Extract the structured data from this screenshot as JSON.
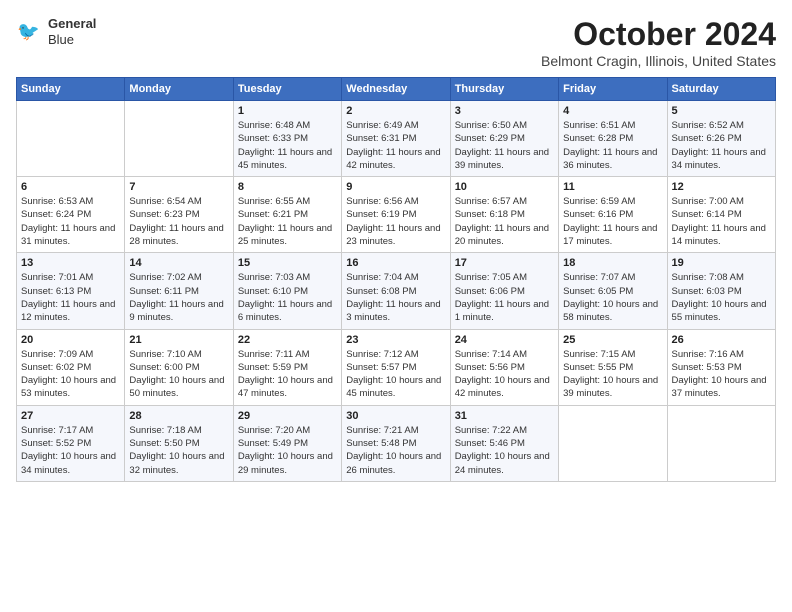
{
  "header": {
    "logo_line1": "General",
    "logo_line2": "Blue",
    "month": "October 2024",
    "location": "Belmont Cragin, Illinois, United States"
  },
  "weekdays": [
    "Sunday",
    "Monday",
    "Tuesday",
    "Wednesday",
    "Thursday",
    "Friday",
    "Saturday"
  ],
  "weeks": [
    [
      {
        "day": "",
        "info": ""
      },
      {
        "day": "",
        "info": ""
      },
      {
        "day": "1",
        "info": "Sunrise: 6:48 AM\nSunset: 6:33 PM\nDaylight: 11 hours and 45 minutes."
      },
      {
        "day": "2",
        "info": "Sunrise: 6:49 AM\nSunset: 6:31 PM\nDaylight: 11 hours and 42 minutes."
      },
      {
        "day": "3",
        "info": "Sunrise: 6:50 AM\nSunset: 6:29 PM\nDaylight: 11 hours and 39 minutes."
      },
      {
        "day": "4",
        "info": "Sunrise: 6:51 AM\nSunset: 6:28 PM\nDaylight: 11 hours and 36 minutes."
      },
      {
        "day": "5",
        "info": "Sunrise: 6:52 AM\nSunset: 6:26 PM\nDaylight: 11 hours and 34 minutes."
      }
    ],
    [
      {
        "day": "6",
        "info": "Sunrise: 6:53 AM\nSunset: 6:24 PM\nDaylight: 11 hours and 31 minutes."
      },
      {
        "day": "7",
        "info": "Sunrise: 6:54 AM\nSunset: 6:23 PM\nDaylight: 11 hours and 28 minutes."
      },
      {
        "day": "8",
        "info": "Sunrise: 6:55 AM\nSunset: 6:21 PM\nDaylight: 11 hours and 25 minutes."
      },
      {
        "day": "9",
        "info": "Sunrise: 6:56 AM\nSunset: 6:19 PM\nDaylight: 11 hours and 23 minutes."
      },
      {
        "day": "10",
        "info": "Sunrise: 6:57 AM\nSunset: 6:18 PM\nDaylight: 11 hours and 20 minutes."
      },
      {
        "day": "11",
        "info": "Sunrise: 6:59 AM\nSunset: 6:16 PM\nDaylight: 11 hours and 17 minutes."
      },
      {
        "day": "12",
        "info": "Sunrise: 7:00 AM\nSunset: 6:14 PM\nDaylight: 11 hours and 14 minutes."
      }
    ],
    [
      {
        "day": "13",
        "info": "Sunrise: 7:01 AM\nSunset: 6:13 PM\nDaylight: 11 hours and 12 minutes."
      },
      {
        "day": "14",
        "info": "Sunrise: 7:02 AM\nSunset: 6:11 PM\nDaylight: 11 hours and 9 minutes."
      },
      {
        "day": "15",
        "info": "Sunrise: 7:03 AM\nSunset: 6:10 PM\nDaylight: 11 hours and 6 minutes."
      },
      {
        "day": "16",
        "info": "Sunrise: 7:04 AM\nSunset: 6:08 PM\nDaylight: 11 hours and 3 minutes."
      },
      {
        "day": "17",
        "info": "Sunrise: 7:05 AM\nSunset: 6:06 PM\nDaylight: 11 hours and 1 minute."
      },
      {
        "day": "18",
        "info": "Sunrise: 7:07 AM\nSunset: 6:05 PM\nDaylight: 10 hours and 58 minutes."
      },
      {
        "day": "19",
        "info": "Sunrise: 7:08 AM\nSunset: 6:03 PM\nDaylight: 10 hours and 55 minutes."
      }
    ],
    [
      {
        "day": "20",
        "info": "Sunrise: 7:09 AM\nSunset: 6:02 PM\nDaylight: 10 hours and 53 minutes."
      },
      {
        "day": "21",
        "info": "Sunrise: 7:10 AM\nSunset: 6:00 PM\nDaylight: 10 hours and 50 minutes."
      },
      {
        "day": "22",
        "info": "Sunrise: 7:11 AM\nSunset: 5:59 PM\nDaylight: 10 hours and 47 minutes."
      },
      {
        "day": "23",
        "info": "Sunrise: 7:12 AM\nSunset: 5:57 PM\nDaylight: 10 hours and 45 minutes."
      },
      {
        "day": "24",
        "info": "Sunrise: 7:14 AM\nSunset: 5:56 PM\nDaylight: 10 hours and 42 minutes."
      },
      {
        "day": "25",
        "info": "Sunrise: 7:15 AM\nSunset: 5:55 PM\nDaylight: 10 hours and 39 minutes."
      },
      {
        "day": "26",
        "info": "Sunrise: 7:16 AM\nSunset: 5:53 PM\nDaylight: 10 hours and 37 minutes."
      }
    ],
    [
      {
        "day": "27",
        "info": "Sunrise: 7:17 AM\nSunset: 5:52 PM\nDaylight: 10 hours and 34 minutes."
      },
      {
        "day": "28",
        "info": "Sunrise: 7:18 AM\nSunset: 5:50 PM\nDaylight: 10 hours and 32 minutes."
      },
      {
        "day": "29",
        "info": "Sunrise: 7:20 AM\nSunset: 5:49 PM\nDaylight: 10 hours and 29 minutes."
      },
      {
        "day": "30",
        "info": "Sunrise: 7:21 AM\nSunset: 5:48 PM\nDaylight: 10 hours and 26 minutes."
      },
      {
        "day": "31",
        "info": "Sunrise: 7:22 AM\nSunset: 5:46 PM\nDaylight: 10 hours and 24 minutes."
      },
      {
        "day": "",
        "info": ""
      },
      {
        "day": "",
        "info": ""
      }
    ]
  ]
}
